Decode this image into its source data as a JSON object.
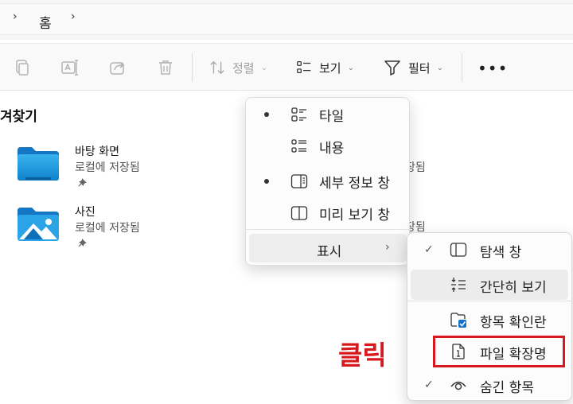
{
  "address_bar": {
    "breadcrumb": [
      "홈"
    ]
  },
  "toolbar": {
    "sort_label": "정렬",
    "view_label": "보기",
    "filter_label": "필터",
    "more_label": "•••"
  },
  "main": {
    "section_title": "겨찾기",
    "items": [
      {
        "name": "바탕 화면",
        "location": "로컬에 저장됨",
        "icon": "desktop-folder-icon"
      },
      {
        "name": "사진",
        "location": "로컬에 저장됨",
        "icon": "pictures-folder-icon"
      }
    ],
    "obscured_sublabels": [
      "장됨",
      "장됨",
      "장됨"
    ]
  },
  "view_menu": {
    "items": [
      {
        "label": "타일",
        "selected": true,
        "icon": "tiles-icon"
      },
      {
        "label": "내용",
        "selected": false,
        "icon": "content-icon"
      },
      {
        "label": "세부 정보 창",
        "selected": true,
        "icon": "details-pane-icon"
      },
      {
        "label": "미리 보기 창",
        "selected": false,
        "icon": "preview-pane-icon"
      }
    ],
    "show_label": "표시"
  },
  "show_submenu": {
    "items": [
      {
        "label": "탐색 창",
        "checked": true,
        "icon": "navigation-pane-icon"
      },
      {
        "label": "간단히 보기",
        "checked": false,
        "icon": "compact-view-icon"
      },
      {
        "label": "항목 확인란",
        "checked": false,
        "icon": "item-checkbox-icon"
      },
      {
        "label": "파일 확장명",
        "checked": false,
        "icon": "file-extension-icon"
      },
      {
        "label": "숨긴 항목",
        "checked": true,
        "icon": "hidden-items-icon"
      }
    ]
  },
  "annotation": {
    "click_label": "클릭",
    "color": "#d7191f"
  }
}
